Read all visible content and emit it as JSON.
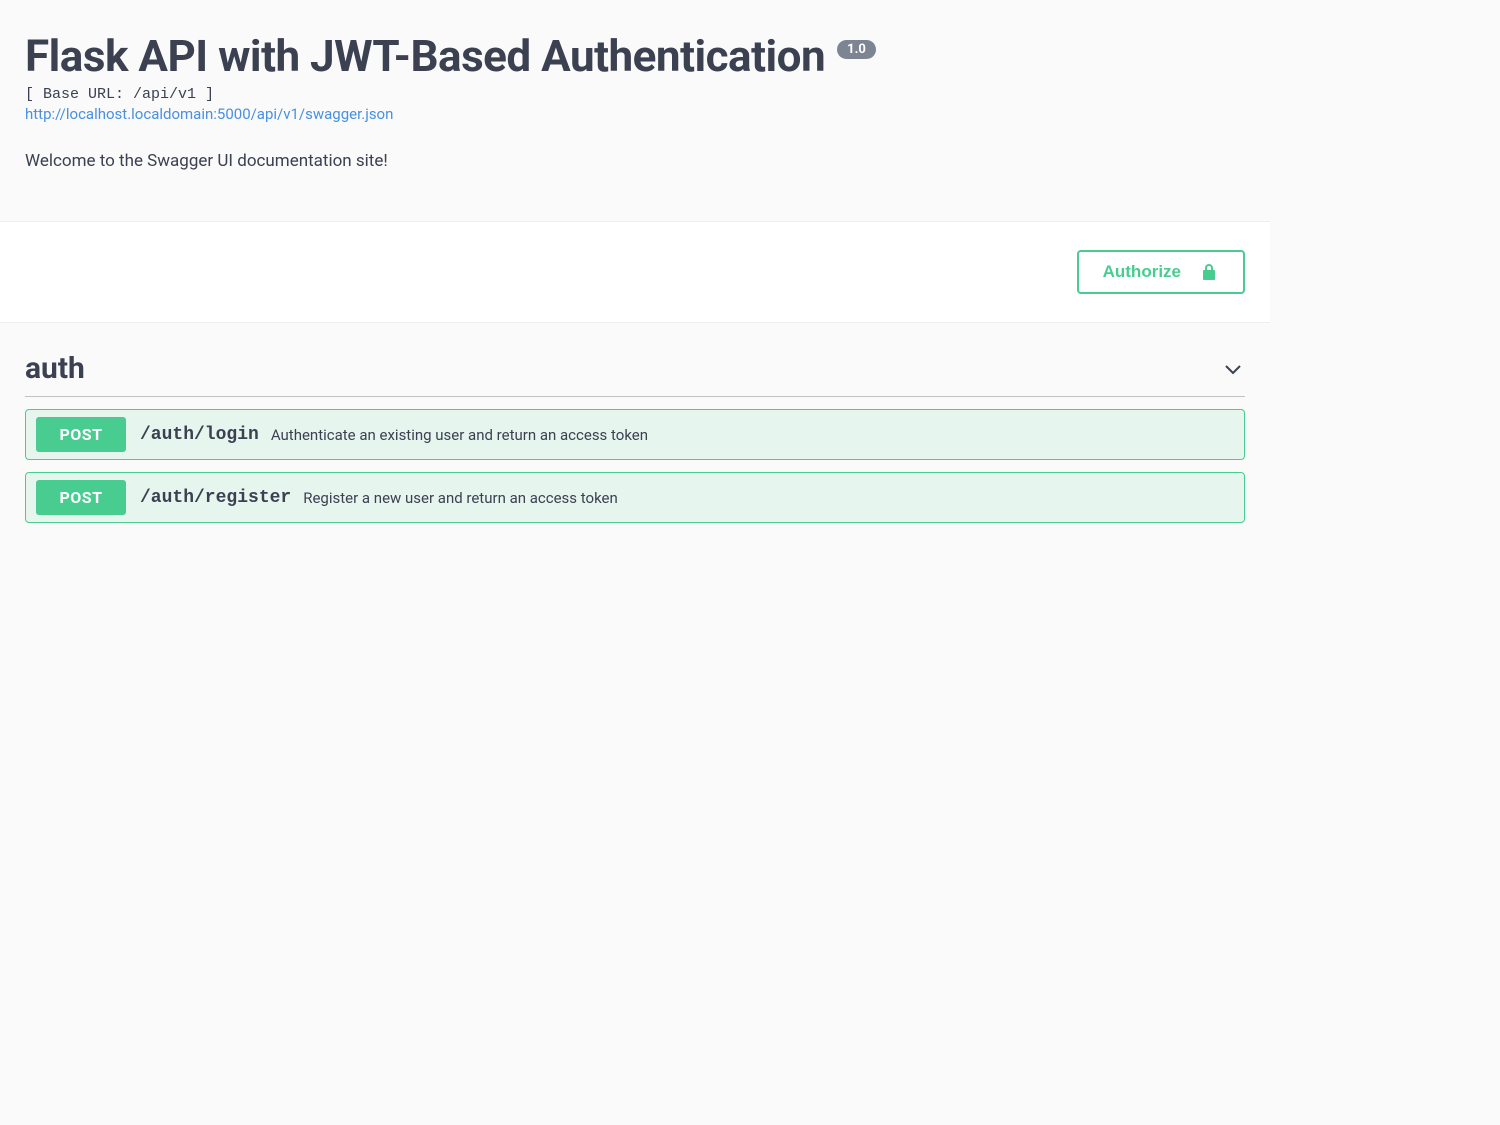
{
  "header": {
    "title": "Flask API with JWT-Based Authentication",
    "version": "1.0",
    "base_url_label": "[ Base URL: /api/v1 ]",
    "swagger_json_url": "http://localhost.localdomain:5000/api/v1/swagger.json",
    "description": "Welcome to the Swagger UI documentation site!"
  },
  "authorize": {
    "label": "Authorize"
  },
  "tags": [
    {
      "name": "auth",
      "operations": [
        {
          "method": "POST",
          "path": "/auth/login",
          "summary": "Authenticate an existing user and return an access token"
        },
        {
          "method": "POST",
          "path": "/auth/register",
          "summary": "Register a new user and return an access token"
        }
      ]
    }
  ]
}
